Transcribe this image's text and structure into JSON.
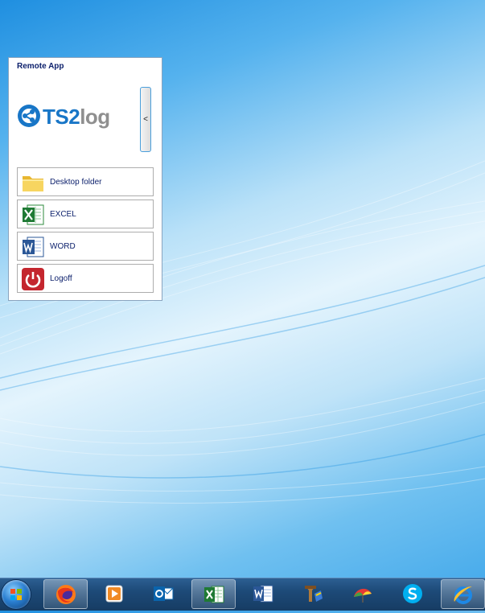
{
  "panel": {
    "title": "Remote App",
    "logo": {
      "primary": "TS2",
      "secondary": "log",
      "colors": {
        "primary": "#1876c7",
        "secondary": "#8f8f8f"
      }
    },
    "collapse_label": "<",
    "apps": [
      {
        "label": "Desktop folder",
        "icon": "folder-icon"
      },
      {
        "label": "EXCEL",
        "icon": "excel-icon"
      },
      {
        "label": "WORD",
        "icon": "word-icon"
      },
      {
        "label": "Logoff",
        "icon": "power-icon"
      }
    ]
  },
  "taskbar": {
    "items": [
      {
        "icon": "start-orb-icon"
      },
      {
        "icon": "firefox-icon",
        "active": true
      },
      {
        "icon": "media-player-icon"
      },
      {
        "icon": "outlook-icon"
      },
      {
        "icon": "excel-icon",
        "active": true
      },
      {
        "icon": "word-icon"
      },
      {
        "icon": "tools-icon"
      },
      {
        "icon": "umbrella-app-icon"
      },
      {
        "icon": "skype-icon"
      },
      {
        "icon": "internet-explorer-icon",
        "active": true
      }
    ]
  }
}
